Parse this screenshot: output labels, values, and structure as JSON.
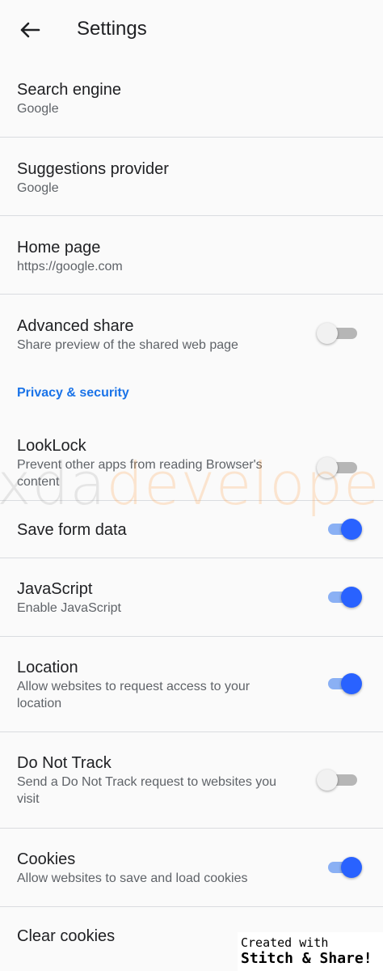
{
  "header": {
    "title": "Settings"
  },
  "rows": {
    "search_engine": {
      "title": "Search engine",
      "subtitle": "Google"
    },
    "suggestions_provider": {
      "title": "Suggestions provider",
      "subtitle": "Google"
    },
    "home_page": {
      "title": "Home page",
      "subtitle": "https://google.com"
    },
    "advanced_share": {
      "title": "Advanced share",
      "subtitle": "Share preview of the shared web page",
      "enabled": false
    }
  },
  "privacy_section": {
    "header": "Privacy & security",
    "looklock": {
      "title": "LookLock",
      "subtitle": "Prevent other apps from reading Browser's content",
      "enabled": false
    },
    "save_form_data": {
      "title": "Save form data",
      "enabled": true
    },
    "javascript": {
      "title": "JavaScript",
      "subtitle": "Enable JavaScript",
      "enabled": true
    },
    "location": {
      "title": "Location",
      "subtitle": "Allow websites to request access to your location",
      "enabled": true
    },
    "do_not_track": {
      "title": "Do Not Track",
      "subtitle": "Send a Do Not Track request to websites you visit",
      "enabled": false
    },
    "cookies": {
      "title": "Cookies",
      "subtitle": "Allow websites to save and load cookies",
      "enabled": true
    },
    "clear_cookies": {
      "title": "Clear cookies"
    }
  },
  "watermark": {
    "left": "xda",
    "right": "developers"
  },
  "stitch_badge": {
    "line1": "Created with",
    "line2": "Stitch & Share!"
  },
  "colors": {
    "accent": "#1a73e8",
    "toggle_on": "#2962ff",
    "toggle_on_track": "#8ab0f4",
    "toggle_off_track": "#b6b6b6",
    "background": "#fafafa",
    "divider": "#dadce0"
  }
}
